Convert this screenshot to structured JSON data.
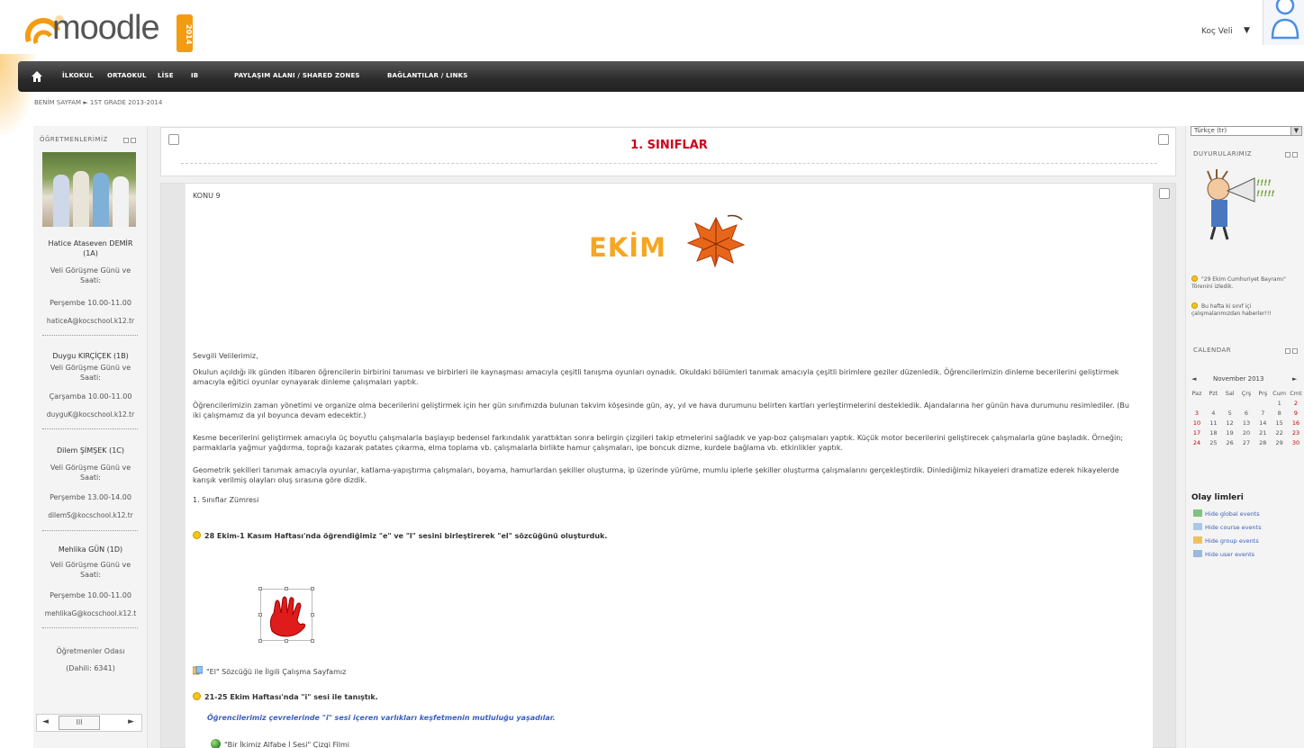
{
  "header": {
    "logo_text": "moodle",
    "logo_year": "2014",
    "user_name": "Koç Veli",
    "user_caret": "▼"
  },
  "navbar": {
    "items": [
      "İLKOKUL",
      "ORTAOKUL",
      "LİSE",
      "IB",
      "PAYLAŞIM ALANI / SHARED ZONES",
      "BAĞLANTILAR / LINKS"
    ]
  },
  "breadcrumb": "BENİM SAYFAM ► 1ST GRADE 2013-2014",
  "left": {
    "block_title": "ÖĞRETMENLERİMİZ",
    "teachers": [
      {
        "name": "Hatice Ataseven DEMİR (1A)",
        "label": "Veli Görüşme Günü ve Saati:",
        "time": "Perşembe 10.00-11.00",
        "email": "haticeA@kocschool.k12.tr"
      },
      {
        "name": "Duygu KIRÇİÇEK (1B)",
        "label": "Veli Görüşme Günü ve Saati:",
        "time": "Çarşamba 10.00-11.00",
        "email": "duyguK@kocschool.k12.tr"
      },
      {
        "name": "Dilem ŞİMŞEK (1C)",
        "label": "Veli Görüşme Günü ve Saati:",
        "time": "Perşembe 13.00-14.00",
        "email": "dilemS@kocschool.k12.tr"
      },
      {
        "name": "Mehlika GÜN (1D)",
        "label": "Veli Görüşme Günü ve Saati:",
        "time": "Perşembe 10.00-11.00",
        "email": "mehlikaG@kocschool.k12.t"
      }
    ],
    "room": "Öğretmenler Odası",
    "room_ext": "(Dahili: 6341)",
    "scroll_left": "◄",
    "scroll_thumb": "III",
    "scroll_right": "►"
  },
  "main": {
    "section_title": "1. SINIFLAR",
    "topic": "KONU 9",
    "banner": "EKİM",
    "greeting": "Sevgili Velilerimiz,",
    "paragraphs": [
      "Okulun açıldığı ilk günden itibaren öğrencilerin birbirini tanıması ve birbirleri ile kaynaşması amacıyla çeşitli tanışma oyunları oynadık. Okuldaki bölümleri tanımak amacıyla çeşitli birimlere geziler düzenledik. Öğrencilerimizin dinleme becerilerini geliştirmek amacıyla eğitici oyunlar oynayarak dinleme çalışmaları yaptık.",
      "Öğrencilerimizin zaman yönetimi ve organize olma becerilerini geliştirmek için her gün sınıfımızda bulunan takvim köşesinde gün, ay, yıl ve hava durumunu belirten kartları yerleştirmelerini destekledik. Ajandalarına her günün hava durumunu resimlediler. (Bu iki çalışmamız da yıl boyunca devam edecektir.)",
      "Kesme becerilerini geliştirmek amacıyla üç boyutlu çalışmalarla başlayıp bedensel farkındalık yarattıktan sonra belirgin çizgileri takip etmelerini sağladık ve yap-boz çalışmaları yaptık. Küçük motor becerilerini geliştirecek çalışmalarla güne başladık. Örneğin; parmaklarla yağmur yağdırma, toprağı kazarak patates çıkarma, elma toplama vb. çalışmalarla birlikte hamur çalışmaları, ipe boncuk dizme, kurdele bağlama vb. etkinlikler yaptık.",
      "Geometrik şekilleri tanımak amacıyla oyunlar, katlama-yapıştırma çalışmaları, boyama, hamurlardan şekiller oluşturma, ip üzerinde yürüme, mumlu iplerle şekiller oluşturma çalışmalarını gerçekleştirdik. Dinlediğimiz hikayeleri dramatize ederek hikayelerde karışık verilmiş olayları oluş sırasına göre dizdik."
    ],
    "signature": "1. Sınıflar Zümresi",
    "week1": "28 Ekim-1 Kasım Haftası'nda öğrendiğimiz \"e\" ve \"l\" sesini birleştirerek \"el\" sözcüğünü oluşturduk.",
    "worksheet": "\"El\" Sözcüğü ile İlgili Çalışma Sayfamız",
    "week2": "21-25 Ekim Haftası'nda \"i\" sesi ile tanıştık.",
    "italic_note": "Öğrencilerimiz çevrelerinde \"i\" sesi içeren varlıkları keşfetmenin mutluluğu yaşadılar.",
    "film": "\"Bir İkimiz Alfabe İ Sesi\" Çizgi Filmi"
  },
  "right": {
    "lang": "Türkçe (tr)",
    "announce_title": "DUYURULARIMIZ",
    "announce_1": "\"29 Ekim Cumhuriyet Bayramı\" Törenini izledik.",
    "announce_2": "Bu hafta ki sınıf içi çalışmalarımızdan haberler!!!",
    "calendar_title": "CALENDAR",
    "month": "November 2013",
    "prev": "◄",
    "next": "►",
    "weekdays": [
      "Paz",
      "Pzt",
      "Sal",
      "Çrş",
      "Prş",
      "Cum",
      "Cmt"
    ],
    "weeks": [
      [
        "",
        "",
        "",
        "",
        "",
        "1",
        "2"
      ],
      [
        "3",
        "4",
        "5",
        "6",
        "7",
        "8",
        "9"
      ],
      [
        "10",
        "11",
        "12",
        "13",
        "14",
        "15",
        "16"
      ],
      [
        "17",
        "18",
        "19",
        "20",
        "21",
        "22",
        "23"
      ],
      [
        "24",
        "25",
        "26",
        "27",
        "28",
        "29",
        "30"
      ]
    ],
    "events_title": "Olay limleri",
    "event_links": [
      "Hide global events",
      "Hide course events",
      "Hide group events",
      "Hide user events"
    ]
  },
  "colors": {
    "accent_red": "#d0021b",
    "banner_orange": "#f5a623",
    "link_blue": "#3b5fbd",
    "navbar": "#2b2b2b"
  }
}
